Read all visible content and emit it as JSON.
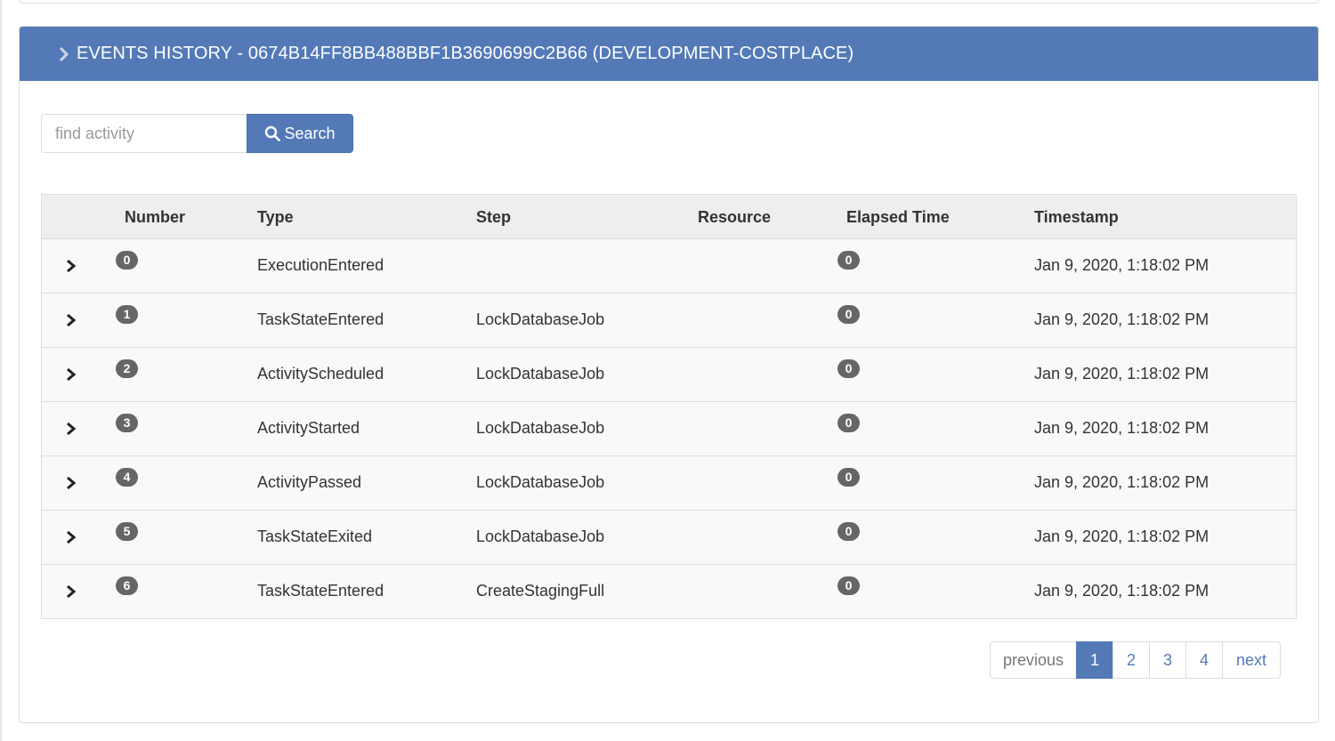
{
  "colors": {
    "accent": "#537ab7",
    "badge": "#666666",
    "header_bg": "#eeeeee",
    "row_bg": "#f9f9f9"
  },
  "panel": {
    "title": "EVENTS HISTORY - 0674B14FF8BB488BBF1B3690699C2B66 (DEVELOPMENT-COSTPLACE)",
    "title_icon": "chevron-right-icon"
  },
  "search": {
    "placeholder": "find activity",
    "value": "",
    "button_label": "Search",
    "button_icon": "search-icon"
  },
  "table": {
    "columns": [
      "Number",
      "Type",
      "Step",
      "Resource",
      "Elapsed Time",
      "Timestamp"
    ],
    "rows": [
      {
        "number": "0",
        "type": "ExecutionEntered",
        "step": "",
        "resource": "",
        "elapsed": "0",
        "timestamp": "Jan 9, 2020, 1:18:02 PM"
      },
      {
        "number": "1",
        "type": "TaskStateEntered",
        "step": "LockDatabaseJob",
        "resource": "",
        "elapsed": "0",
        "timestamp": "Jan 9, 2020, 1:18:02 PM"
      },
      {
        "number": "2",
        "type": "ActivityScheduled",
        "step": "LockDatabaseJob",
        "resource": "",
        "elapsed": "0",
        "timestamp": "Jan 9, 2020, 1:18:02 PM"
      },
      {
        "number": "3",
        "type": "ActivityStarted",
        "step": "LockDatabaseJob",
        "resource": "",
        "elapsed": "0",
        "timestamp": "Jan 9, 2020, 1:18:02 PM"
      },
      {
        "number": "4",
        "type": "ActivityPassed",
        "step": "LockDatabaseJob",
        "resource": "",
        "elapsed": "0",
        "timestamp": "Jan 9, 2020, 1:18:02 PM"
      },
      {
        "number": "5",
        "type": "TaskStateExited",
        "step": "LockDatabaseJob",
        "resource": "",
        "elapsed": "0",
        "timestamp": "Jan 9, 2020, 1:18:02 PM"
      },
      {
        "number": "6",
        "type": "TaskStateEntered",
        "step": "CreateStagingFull",
        "resource": "",
        "elapsed": "0",
        "timestamp": "Jan 9, 2020, 1:18:02 PM"
      }
    ]
  },
  "pagination": {
    "previous": "previous",
    "pages": [
      "1",
      "2",
      "3",
      "4"
    ],
    "active_page": "1",
    "next": "next"
  }
}
